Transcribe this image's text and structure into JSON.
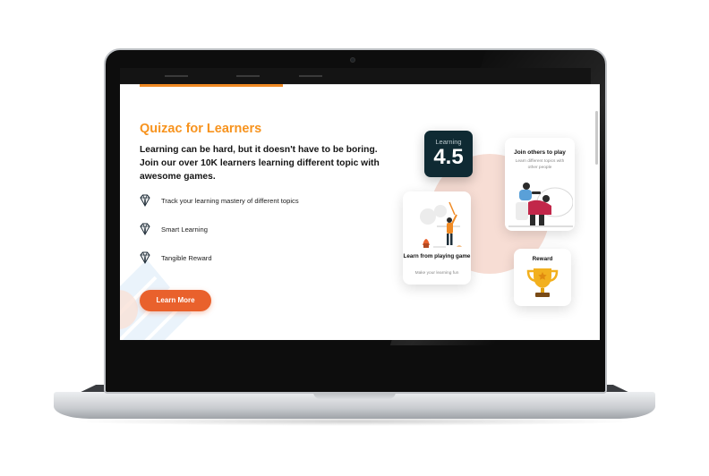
{
  "hero": {
    "title": "Quizac for Learners",
    "lead": "Learning can be hard, but it doesn't have to be boring. Join our over 10K learners learning different topic with awesome games.",
    "features": [
      {
        "label": "Track your learning mastery of different topics",
        "icon": "diamond-icon"
      },
      {
        "label": "Smart Learning",
        "icon": "diamond-icon"
      },
      {
        "label": "Tangible Reward",
        "icon": "diamond-icon"
      }
    ],
    "cta_label": "Learn More"
  },
  "cards": {
    "rating": {
      "label": "Learning",
      "value": "4.5"
    },
    "join": {
      "title": "Join others to play",
      "subtitle": "Learn different topics with other people"
    },
    "learn": {
      "title": "Learn from playing game",
      "subtitle": "Make your learning fun"
    },
    "reward": {
      "title": "Reward",
      "icon": "trophy-icon"
    }
  },
  "colors": {
    "accent": "#f7931e",
    "button": "#e9612c",
    "rating_bg": "#0f2a33"
  }
}
